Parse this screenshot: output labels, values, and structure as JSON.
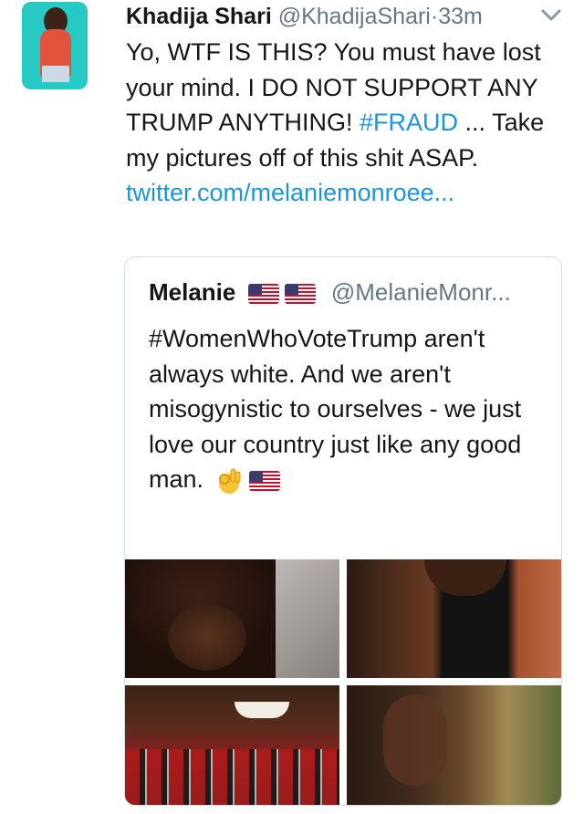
{
  "tweet": {
    "author_name": "Khadija Shari",
    "author_handle": "@KhadijaShari",
    "separator": "·",
    "time": "33m",
    "text_before_hashtag": "Yo, WTF IS THIS? You must have lost your mind. I DO NOT SUPPORT ANY TRUMP ANYTHING! ",
    "hashtag": "#FRAUD",
    "text_after_hashtag": " ... Take my pictures off of this shit ASAP. ",
    "link": "twitter.com/melaniemonroee...",
    "avatar_icon": "profile-photo",
    "menu_icon": "chevron-down-icon"
  },
  "quoted_tweet": {
    "author_name": "Melanie",
    "author_handle": "@MelanieMonr...",
    "name_emoji_icons": [
      "us-flag-icon",
      "us-flag-icon"
    ],
    "text": "#WomenWhoVoteTrump aren't always white. And we aren't misogynistic to ourselves - we just love our country just like any good man.",
    "text_emoji_icons": [
      "ok-hand-icon",
      "us-flag-icon"
    ],
    "media": [
      "photo-1",
      "photo-2",
      "photo-3",
      "photo-4"
    ]
  },
  "colors": {
    "link": "#1b95e0",
    "muted": "#657786",
    "border": "#d6dde3",
    "text": "#14171a"
  }
}
